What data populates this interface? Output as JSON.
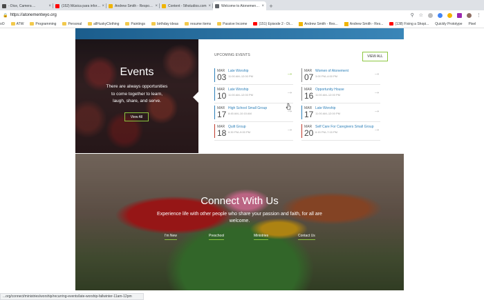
{
  "browser": {
    "tabs": [
      {
        "title": "- Dice, Camera ...",
        "close": "×",
        "favicon_color": "#4a4a4a",
        "active": false
      },
      {
        "title": "(152) Música para informáti...",
        "close": "×",
        "favicon_color": "#ff0000",
        "active": false
      },
      {
        "title": "Andrew Smith - Responsive Re...",
        "close": "×",
        "favicon_color": "#f0b400",
        "active": false
      },
      {
        "title": "Content - 5thstudios.com",
        "close": "×",
        "favicon_color": "#f0b400",
        "active": false
      },
      {
        "title": "Welcome to Atonement Luthera...",
        "close": "×",
        "favicon_color": "#5f6368",
        "active": true
      }
    ],
    "new_tab": "+",
    "url": "https://atonementwyo.org",
    "bookmarks": [
      {
        "label": "oO",
        "type": "none"
      },
      {
        "label": "ATW",
        "type": "folder"
      },
      {
        "label": "Programming",
        "type": "folder"
      },
      {
        "label": "Personal",
        "type": "folder"
      },
      {
        "label": "allHuskyClothing",
        "type": "folder"
      },
      {
        "label": "Paintings",
        "type": "folder"
      },
      {
        "label": "birthday ideas",
        "type": "folder"
      },
      {
        "label": "resume items",
        "type": "folder"
      },
      {
        "label": "Passive Income",
        "type": "folder"
      },
      {
        "label": "(151) Episode 2 - Di...",
        "type": "yt"
      },
      {
        "label": "Andrew Smith - Res...",
        "type": "yico"
      },
      {
        "label": "Andrew Smith - Res...",
        "type": "yico"
      },
      {
        "label": "(138) Fixing a Shopi...",
        "type": "yt"
      },
      {
        "label": "Quickly Prototype",
        "type": "none"
      },
      {
        "label": "Pixel",
        "type": "none"
      }
    ],
    "status_url": "...org/connect/ministries/worship/recurring-events/late-worship-fallwinter-11am-12pm"
  },
  "events": {
    "title": "Events",
    "description": "There are always opportunities to come together to learn, laugh, share, and serve.",
    "view_all": "View All"
  },
  "upcoming": {
    "heading": "UPCOMING EVENTS",
    "view_all": "VIEW ALL",
    "items": [
      {
        "month": "MAR",
        "day": "03",
        "name": "Late Worship",
        "time": "11:00 AM–12:00 PM",
        "bar_color": "#2c7fb8",
        "arrow_color": "#8cc63f"
      },
      {
        "month": "MAR",
        "day": "07",
        "name": "Women of Atonement",
        "time": "3:00 PM–4:00 PM",
        "bar_color": "#888888",
        "arrow_color": "#aaaaaa"
      },
      {
        "month": "MAR",
        "day": "10",
        "name": "Late Worship",
        "time": "11:00 AM–12:00 PM",
        "bar_color": "#2c7fb8",
        "arrow_color": "#aaaaaa"
      },
      {
        "month": "MAR",
        "day": "16",
        "name": "Opportunity House",
        "time": "11:00 AM–12:00 PM",
        "bar_color": "#888888",
        "arrow_color": "#aaaaaa"
      },
      {
        "month": "MAR",
        "day": "17",
        "name": "High School Small Group",
        "time": "8:45 AM–10:15 AM",
        "bar_color": "#2c7fb8",
        "arrow_color": "#aaaaaa"
      },
      {
        "month": "MAR",
        "day": "17",
        "name": "Late Worship",
        "time": "11:00 AM–12:00 PM",
        "bar_color": "#2c7fb8",
        "arrow_color": "#aaaaaa"
      },
      {
        "month": "MAR",
        "day": "18",
        "name": "Quilt Group",
        "time": "6:30 PM–9:00 PM",
        "bar_color": "#c0392b",
        "arrow_color": "#aaaaaa"
      },
      {
        "month": "MAR",
        "day": "20",
        "name": "Self Care For Caregivers Small Group",
        "time": "6:15 PM–7:15 PM",
        "bar_color": "#c0392b",
        "arrow_color": "#aaaaaa"
      }
    ]
  },
  "connect": {
    "title": "Connect With Us",
    "description": "Experience life with other people who share your passion and faith, for all are welcome.",
    "links": [
      "I'm New",
      "Preschool",
      "Ministries",
      "Contact Us"
    ]
  },
  "colors": {
    "accent_green": "#8cc63f",
    "link_blue": "#2c7fb8",
    "band_blue": "#1b5d8c"
  }
}
